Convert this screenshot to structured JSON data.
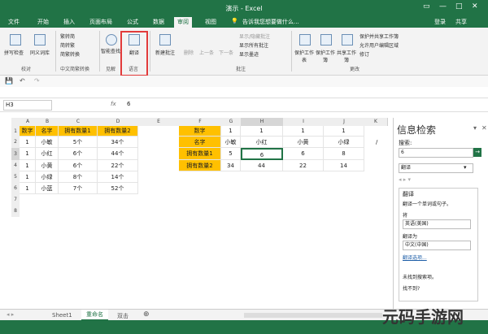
{
  "window": {
    "title": "演示 - Excel",
    "signin": "登录",
    "share": "共享"
  },
  "tabs": [
    "文件",
    "开始",
    "插入",
    "页面布局",
    "公式",
    "数据",
    "审阅",
    "视图"
  ],
  "tellme": "告诉我您想要做什么...",
  "ribbon": {
    "proofing": {
      "spell": "拼写检查",
      "thesaurus": "同义词库",
      "group": "校对"
    },
    "chinese": {
      "to_trad": "繁转简",
      "to_simp": "简转繁",
      "convert": "简繁转换",
      "group": "中文简繁转换"
    },
    "insights": {
      "smart": "智能查找",
      "group": "见解"
    },
    "language": {
      "translate": "翻译",
      "group": "语言"
    },
    "comments": {
      "new": "新建批注",
      "delete": "删除",
      "prev": "上一条",
      "next": "下一条",
      "show_hide": "显示/隐藏批注",
      "show_all": "显示所有批注",
      "show_ink": "显示墨迹",
      "group": "批注"
    },
    "changes": {
      "protect_sheet": "保护工作表",
      "protect_book": "保护工作簿",
      "share_book": "共享工作簿",
      "protect_share": "保护并共享工作簿",
      "allow_edit": "允许用户编辑区域",
      "track": "修订",
      "group": "更改"
    }
  },
  "formula": {
    "namebox": "H3",
    "fx": "fx",
    "value": "6"
  },
  "grid": {
    "columns": [
      "A",
      "B",
      "C",
      "D",
      "E",
      "F",
      "G",
      "H",
      "I",
      "J"
    ],
    "rows": [
      "1",
      "2",
      "3",
      "4",
      "5",
      "6",
      "7",
      "8"
    ],
    "left_table": [
      [
        "数字",
        "名字",
        "拥有数量1",
        "拥有数量2"
      ],
      [
        "1",
        "小敏",
        "5个",
        "34个"
      ],
      [
        "1",
        "小红",
        "6个",
        "44个"
      ],
      [
        "1",
        "小黄",
        "6个",
        "22个"
      ],
      [
        "1",
        "小绿",
        "8个",
        "14个"
      ],
      [
        "1",
        "小蓝",
        "7个",
        "52个"
      ]
    ],
    "right_table": [
      [
        "数字",
        "1",
        "1",
        "1",
        "1"
      ],
      [
        "名字",
        "小敏",
        "小红",
        "小黄",
        "小绿"
      ],
      [
        "拥有数量1",
        "5",
        "6",
        "6",
        "8"
      ],
      [
        "拥有数量2",
        "34",
        "44",
        "22",
        "14"
      ]
    ],
    "extra_col_letter": "K",
    "extra_row2_cell": "/"
  },
  "pane": {
    "title": "信息检索",
    "search_label": "搜索:",
    "search_value": "6",
    "source": "翻译",
    "section": "翻译",
    "hint": "翻译一个单词或句子。",
    "from_label": "将",
    "from_value": "英语(美国)",
    "to_label": "翻译为",
    "to_value": "中文(中国)",
    "options_link": "翻译选项...",
    "notfound": "未找到搜索项。",
    "notfound2": "找不到?"
  },
  "sheets": [
    "Sheet1",
    "重命名",
    "双击"
  ],
  "watermark": "元码手游网"
}
